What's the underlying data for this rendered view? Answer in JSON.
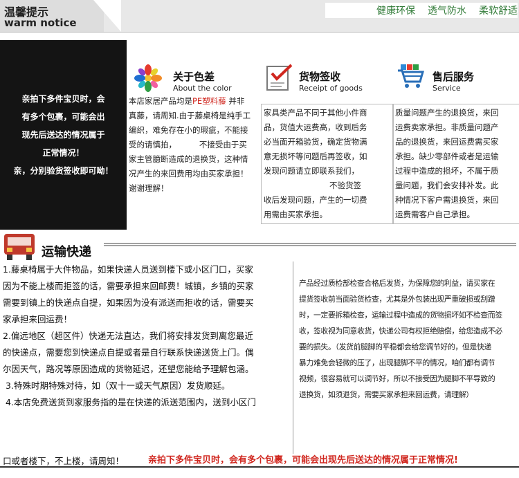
{
  "header": {
    "title_cn": "温馨提示",
    "title_en": "warm notice",
    "tags": [
      "健康环保",
      "透气防水",
      "柔软舒适"
    ]
  },
  "left_notice": {
    "lines": [
      "亲拍下多件宝贝时，会",
      "有多个包裹，可能会出",
      "现先后送达的情况属于",
      "正常情况！",
      "亲，分别验货签收即可呦！"
    ]
  },
  "color_col": {
    "title": "关于色差",
    "subtitle": "About the color",
    "line1_prefix": "本店家居产品均是",
    "line1_red": "PE塑料藤",
    "line1_suffix": " 并非",
    "lines": [
      "真藤，请周知.由于藤桌椅是纯手工",
      "编织，难免存在小的瑕疵，不能接",
      "受的请慎拍，         不接受由于买",
      "家主管臆断造成的退换货，这种情",
      "况产生的来回费用均由买家承担！",
      "谢谢理解！"
    ]
  },
  "receipt_col": {
    "title": "货物签收",
    "subtitle": "Receipt of goods",
    "lines": [
      "家具类产品不同于其他小件商",
      "品，货值大运费高，收到后务",
      "必当面开箱验货，确定货物满",
      "意无损坏等问题后再签收，如",
      "发现问题请立即联系我们，",
      "                          不验货签",
      "收后发现问题，产生的一切费",
      "用需由买家承担。"
    ]
  },
  "service_col": {
    "title": "售后服务",
    "subtitle": "Service",
    "lines": [
      "质量问题产生的退换货，来回",
      "运费卖家承担。非质量问题产",
      "品的退换货，来回运费需买家",
      "承担。缺少零部件或者是运输",
      "过程中造成的损坏，不属于质",
      "量问题，我们会安排补发。此",
      "种情况下客户需退换货，来回",
      "运费需客户自己承担。"
    ]
  },
  "shipping": {
    "title": "运输快递",
    "left_lines": [
      "1.藤桌椅属于大件物品，如果快递人员送到楼下或小区门口，买家",
      "因为不能上楼而拒签的话，需要承担来回邮费！城镇，乡镇的买家",
      "需要到镇上的快递点自提，如果因为没有派送而拒收的话，需要买",
      "家承担来回运费！",
      "2.偏远地区（超区件）快递无法直达，我们将安排发货到离您最近",
      "的快递点，需要您到快递点自提或者是自行联系快递送货上门。偶",
      "尔因天气，路况等原因造成的货物延迟，还望您能给予理解包涵。",
      " 3.特殊时期特殊对待，如（双十一或天气原因）发货顺延。",
      " 4.本店免费送货到家服务指的是在快递的派送范围内，送到小区门"
    ],
    "foot_left": "口或者楼下，不上楼，请周知！",
    "foot_red": "亲拍下多件宝贝时，会有多个包裹，可能会出现先后送达的情况属于正常情况!",
    "right_lines": [
      "产品经过质检部检查合格后发货，为保障您的利益，请买家在",
      "提货签收前当面验货检查，尤其是外包装出现严重破损或刮蹭",
      "时，一定要拆箱检查，运输过程中造成的货物损坏如不检查而签",
      "收，签收视为同意收货，快递公司有权拒绝赔偿，给您造成不必",
      "要的损失。（发货前腿脚的平稳都会给您调节好的，但是快递",
      "暴力难免会轻微的压了，出现腿脚不平的情况，咱们都有调节",
      "视频，很容易就可以调节好，所以不接受因为腿脚不平导致的",
      "退换货，如须退货，需要买家承担来回运费，请理解）"
    ]
  },
  "colors": {
    "accent_red": "#d0261e",
    "tag_green": "#2f7a36",
    "panel_black": "#141414"
  },
  "icons": [
    "color-palette-icon",
    "checklist-icon",
    "shopping-cart-icon",
    "truck-icon"
  ]
}
